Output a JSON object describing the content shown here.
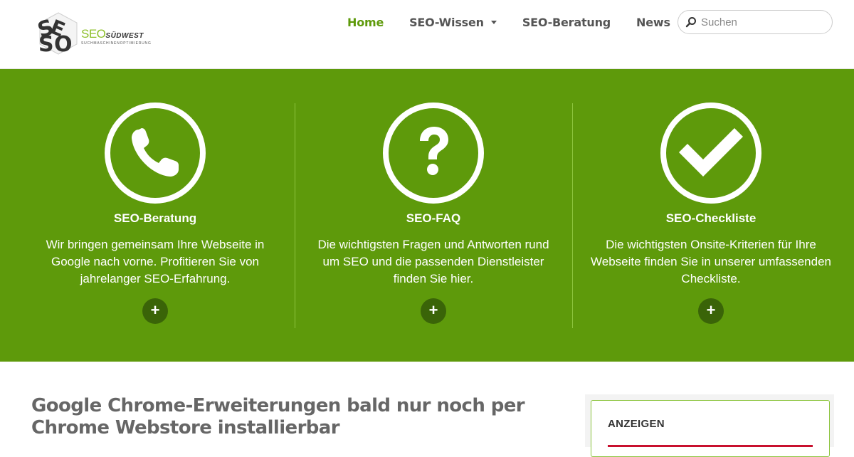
{
  "header": {
    "logo": {
      "mark": "SEO",
      "brand_main": "SEO",
      "brand_accent": "SÜDWEST",
      "tagline": "SUCHMASCHINENOPTIMIERUNG"
    },
    "nav": [
      {
        "label": "Home",
        "active": true,
        "has_dropdown": false
      },
      {
        "label": "SEO-Wissen",
        "active": false,
        "has_dropdown": true
      },
      {
        "label": "SEO-Beratung",
        "active": false,
        "has_dropdown": false
      },
      {
        "label": "News",
        "active": false,
        "has_dropdown": true
      }
    ],
    "search": {
      "placeholder": "Suchen",
      "value": "",
      "icon": "search-icon"
    }
  },
  "features": [
    {
      "icon": "phone-icon",
      "title": "SEO-Beratung",
      "text": "Wir bringen gemeinsam Ihre Webseite in Google nach vorne. Profitieren Sie von jahrelanger SEO-Erfahrung.",
      "button": "+"
    },
    {
      "icon": "question-mark-icon",
      "title": "SEO-FAQ",
      "text": "Die wichtigsten Fragen und Antworten rund um SEO und die passenden Dienstleister finden Sie hier.",
      "button": "+"
    },
    {
      "icon": "checkmark-icon",
      "title": "SEO-Checkliste",
      "text": "Die wichtigsten Onsite-Kriterien für Ihre Webseite finden Sie in unserer umfassenden Checkliste.",
      "button": "+"
    }
  ],
  "article": {
    "title": "Google Chrome-Erweiterungen bald nur noch per Chrome Webstore installierbar"
  },
  "sidebar": {
    "ads_title": "ANZEIGEN"
  },
  "colors": {
    "brand_green": "#5e9a0b",
    "dark_green": "#3a6408",
    "ad_accent": "#c8102e"
  }
}
